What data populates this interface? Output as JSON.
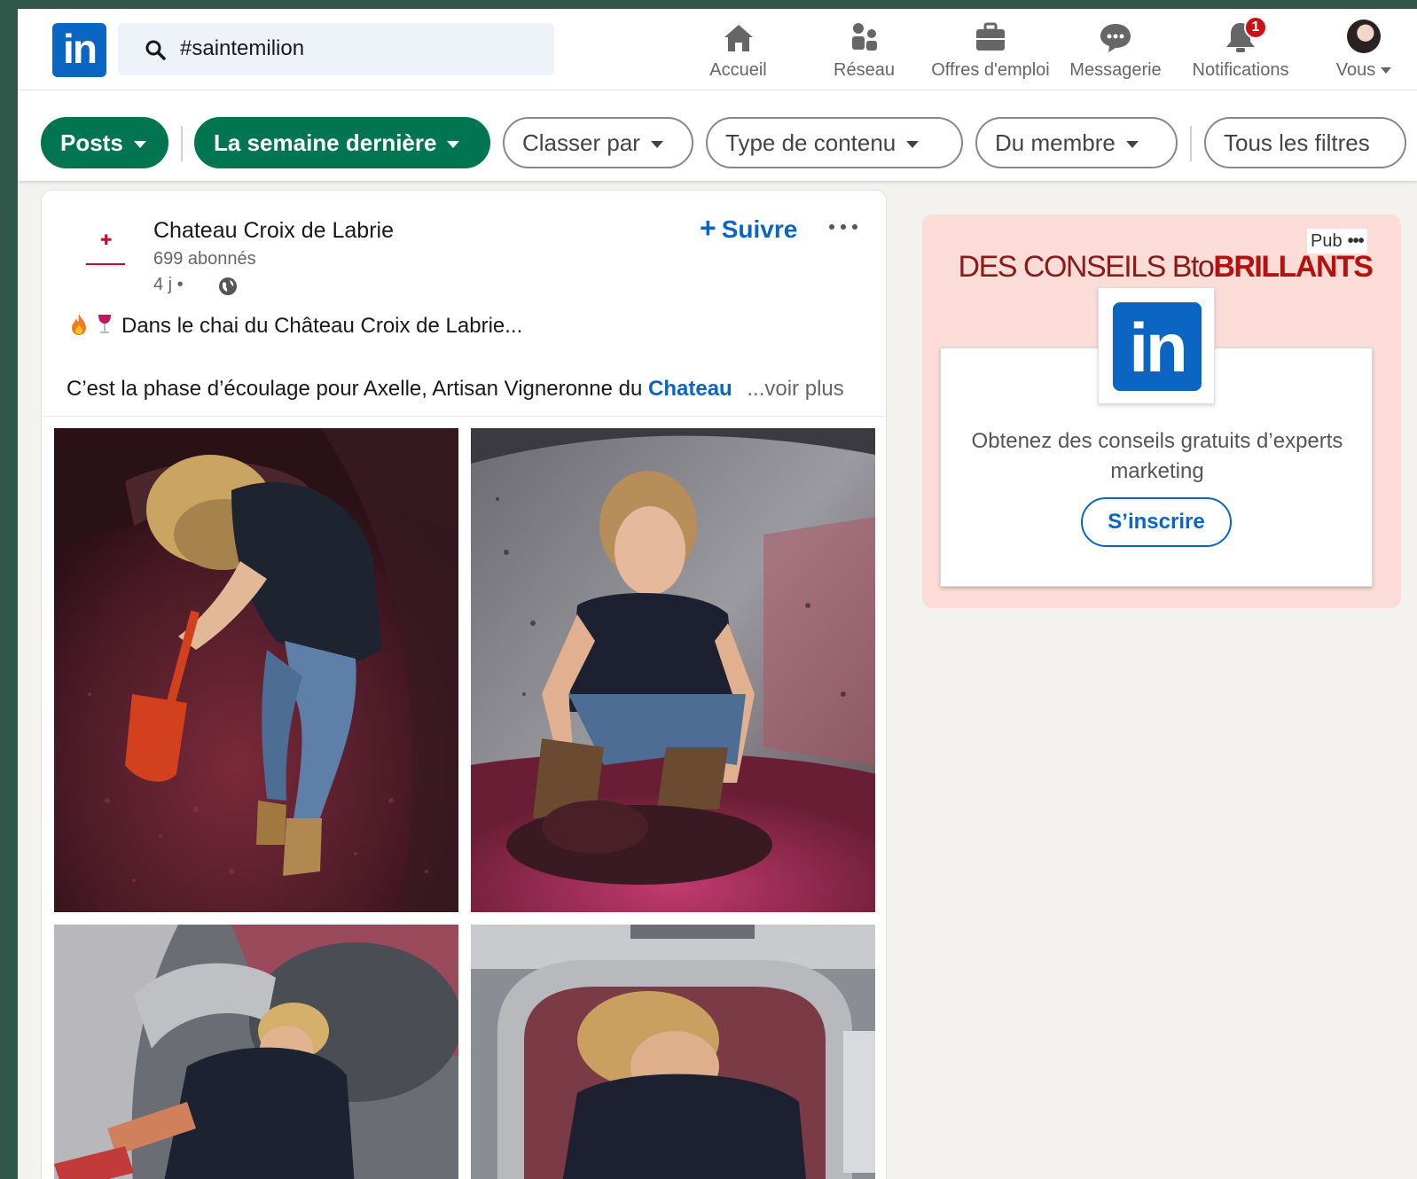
{
  "colors": {
    "brand": "#0a66c2",
    "active_pill": "#01754f",
    "badge": "#cc1016",
    "ad_background": "#fcdcd6"
  },
  "search": {
    "value": "#saintemilion"
  },
  "nav": {
    "items": [
      {
        "label": "Accueil",
        "icon": "home-icon"
      },
      {
        "label": "Réseau",
        "icon": "network-icon"
      },
      {
        "label": "Offres d'emploi",
        "icon": "briefcase-icon"
      },
      {
        "label": "Messagerie",
        "icon": "message-icon"
      },
      {
        "label": "Notifications",
        "icon": "bell-icon",
        "badge": "1"
      },
      {
        "label": "Vous",
        "icon": "avatar"
      }
    ]
  },
  "filters": {
    "posts": "Posts",
    "date": "La semaine dernière",
    "sort": "Classer par",
    "content_type": "Type de contenu",
    "member": "Du membre",
    "all": "Tous les filtres"
  },
  "post": {
    "author": "Chateau Croix de Labrie",
    "followers": "699 abonnés",
    "time": "4 j •",
    "follow_label": "Suivre",
    "line1": "Dans le chai du Château Croix de Labrie...",
    "line2_prefix": "C’est la phase d’écoulage pour Axelle, Artisan Vigneronne du",
    "line2_link": "Chateau",
    "see_more": "...voir plus"
  },
  "ad": {
    "label": "Pub",
    "headline_prefix": "DES CONSEILS Bto",
    "headline_bold": "BRILLANTS",
    "logo_text": "in",
    "text": "Obtenez des conseils gratuits d’experts marketing",
    "cta": "S’inscrire"
  }
}
